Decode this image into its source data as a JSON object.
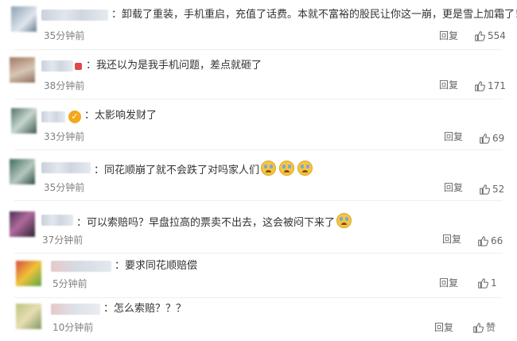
{
  "comments": [
    {
      "text": "：卸载了重装，手机重启，充值了话费。本就不富裕的股民让你这一崩，更是雪上加霜了！",
      "time": "35分钟前",
      "reply": "回复",
      "likes": "554"
    },
    {
      "text": "：我还以为是我手机问题，差点就砸了",
      "time": "38分钟前",
      "reply": "回复",
      "likes": "171"
    },
    {
      "text": "：太影响发财了",
      "time": "33分钟前",
      "reply": "回复",
      "likes": "69"
    },
    {
      "text": "：同花顺崩了就不会跌了对吗家人们",
      "time": "35分钟前",
      "reply": "回复",
      "likes": "52"
    },
    {
      "text": "：可以索赔吗？早盘拉高的票卖不出去，这会被闷下来了",
      "time": "37分钟前",
      "reply": "回复",
      "likes": "66"
    },
    {
      "text": "：要求同花顺赔偿",
      "time": "5分钟前",
      "reply": "回复",
      "likes": "1"
    },
    {
      "text": "：怎么索赔？？？",
      "time": "10分钟前",
      "reply": "回复",
      "likes": "赞"
    }
  ],
  "icons": {
    "like": "thumbs-up-icon",
    "verified": "verified-badge-icon",
    "emoji": "crying-emoji-icon"
  },
  "colors": {
    "text": "#333333",
    "meta": "#808080",
    "badge": "#f3a81a"
  }
}
